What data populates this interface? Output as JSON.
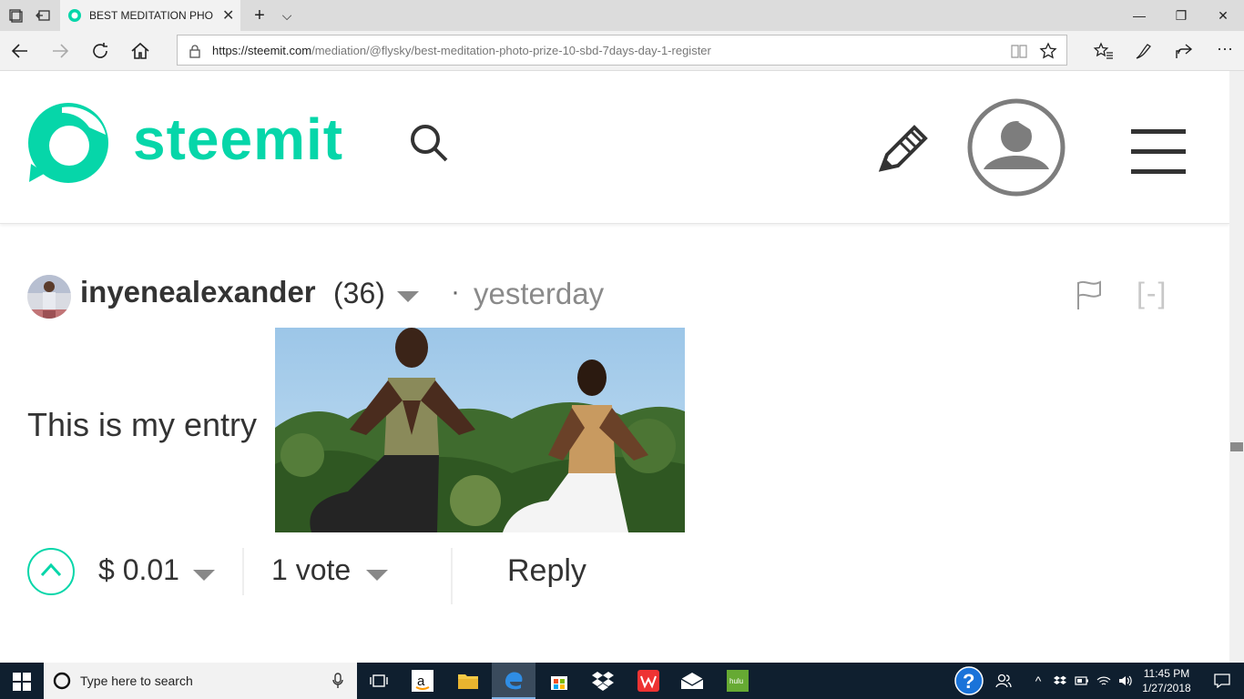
{
  "browser": {
    "tab_title": "BEST MEDITATION PHO",
    "url_domain": "https://steemit.com",
    "url_path": "/mediation/@flysky/best-meditation-photo-prize-10-sbd-7days-day-1-register"
  },
  "site": {
    "logo_text": "steemit",
    "brand_color": "#06d6a9"
  },
  "post": {
    "author": "inyenealexander",
    "reputation": "(36)",
    "separator": "·",
    "time": "yesterday",
    "collapse_label": "[-]",
    "body_text": "This is my entry",
    "payout": "$ 0.01",
    "votes": "1 vote",
    "reply": "Reply"
  },
  "taskbar": {
    "search_placeholder": "Type here to search",
    "time": "11:45 PM",
    "date": "1/27/2018"
  }
}
